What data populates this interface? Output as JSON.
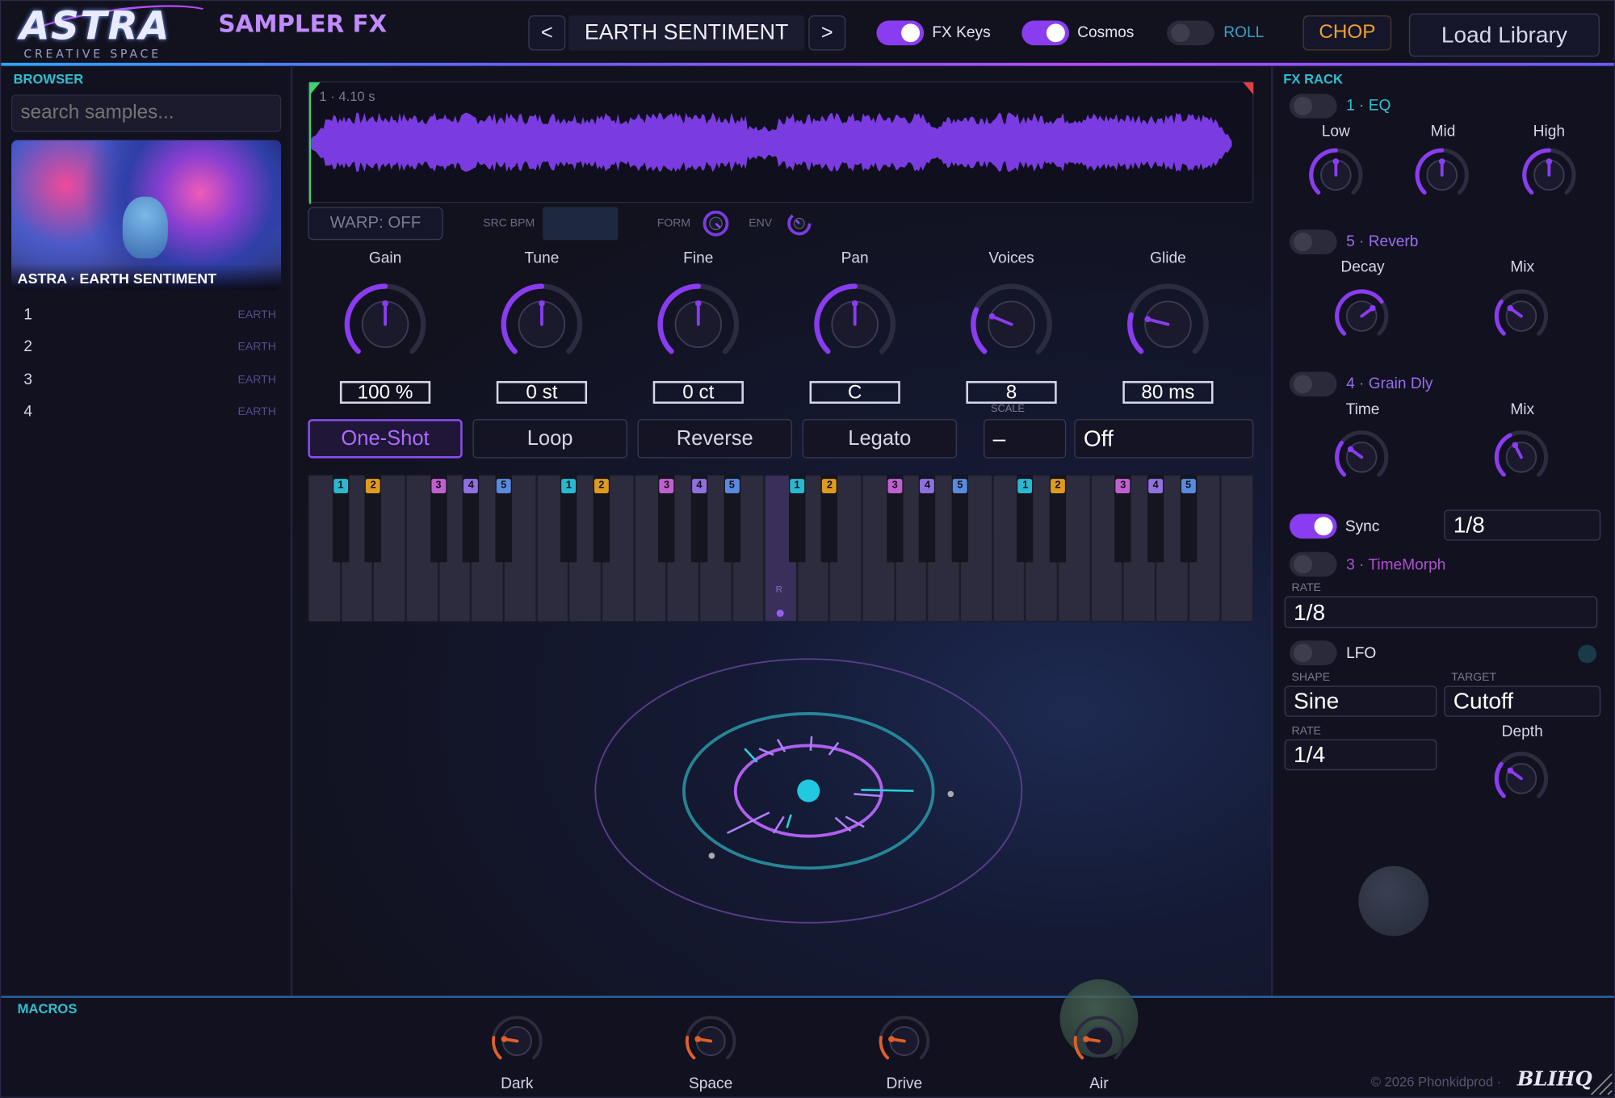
{
  "header": {
    "logo": "ASTRA",
    "logo_sub": "CREATIVE SPACE",
    "product": "SAMPLER FX",
    "prev_label": "<",
    "next_label": ">",
    "preset": "EARTH SENTIMENT",
    "fx_keys_label": "FX Keys",
    "fx_keys_on": true,
    "cosmos_label": "Cosmos",
    "cosmos_on": true,
    "roll_label": "ROLL",
    "roll_on": false,
    "chop_label": "CHOP",
    "load_library_label": "Load Library"
  },
  "browser": {
    "title": "BROWSER",
    "search_placeholder": "search samples...",
    "art_caption": "ASTRA · EARTH SENTIMENT",
    "items": [
      {
        "num": "1",
        "tag": "EARTH"
      },
      {
        "num": "2",
        "tag": "EARTH"
      },
      {
        "num": "3",
        "tag": "EARTH"
      },
      {
        "num": "4",
        "tag": "EARTH"
      }
    ]
  },
  "waveform": {
    "info": "1 · 4.10 s",
    "warp_label": "WARP: OFF",
    "src_bpm_label": "SRC BPM",
    "src_bpm_value": "",
    "form_label": "FORM",
    "env_label": "ENV"
  },
  "knobs": [
    {
      "label": "Gain",
      "value": "100 %",
      "level": 0.5
    },
    {
      "label": "Tune",
      "value": "0 st",
      "level": 0.5
    },
    {
      "label": "Fine",
      "value": "0 ct",
      "level": 0.5
    },
    {
      "label": "Pan",
      "value": "C",
      "level": 0.5
    },
    {
      "label": "Voices",
      "value": "8",
      "level": 0.25
    },
    {
      "label": "Glide",
      "value": "80 ms",
      "level": 0.22
    }
  ],
  "modes": {
    "one_shot": "One-Shot",
    "loop": "Loop",
    "reverse": "Reverse",
    "legato": "Legato",
    "active": "One-Shot",
    "scale_label": "SCALE",
    "scale_value": "–",
    "scale_mode": "Off"
  },
  "keyboard": {
    "root_label": "R",
    "slot_labels": [
      "1",
      "2",
      "3",
      "4",
      "5"
    ]
  },
  "fx_rack": {
    "title": "FX RACK",
    "eq": {
      "title": "1 · EQ",
      "on": false,
      "knobs": [
        {
          "label": "Low",
          "level": 0.5
        },
        {
          "label": "Mid",
          "level": 0.5
        },
        {
          "label": "High",
          "level": 0.5
        }
      ]
    },
    "reverb": {
      "title": "5 · Reverb",
      "on": false,
      "decay_label": "Decay",
      "decay_level": 0.7,
      "mix_label": "Mix",
      "mix_level": 0.3
    },
    "grain": {
      "title": "4 · Grain Dly",
      "on": false,
      "time_label": "Time",
      "time_level": 0.3,
      "mix_label": "Mix",
      "mix_level": 0.4
    },
    "sync_label": "Sync",
    "sync_on": true,
    "sync_value": "1/8",
    "timemorph": {
      "title": "3 · TimeMorph",
      "on": false,
      "rate_label": "RATE",
      "rate_value": "1/8"
    },
    "lfo": {
      "title": "LFO",
      "on": false,
      "shape_label": "SHAPE",
      "shape_value": "Sine",
      "target_label": "TARGET",
      "target_value": "Cutoff",
      "rate_label": "RATE",
      "rate_value": "1/4",
      "depth_label": "Depth",
      "depth_level": 0.3
    }
  },
  "macros": {
    "title": "MACROS",
    "knobs": [
      {
        "label": "Dark",
        "level": 0.2
      },
      {
        "label": "Space",
        "level": 0.2
      },
      {
        "label": "Drive",
        "level": 0.2
      },
      {
        "label": "Air",
        "level": 0.2
      }
    ]
  },
  "footer": {
    "copyright": "© 2026 Phonkidprod ·",
    "brand": "BLIHQ"
  },
  "colors": {
    "accent": "#8a3cf0",
    "teal": "#2fbfd0",
    "chop": "#f0a030",
    "macro_orange": "#e0602a",
    "waveform": "#7a3ce0"
  }
}
